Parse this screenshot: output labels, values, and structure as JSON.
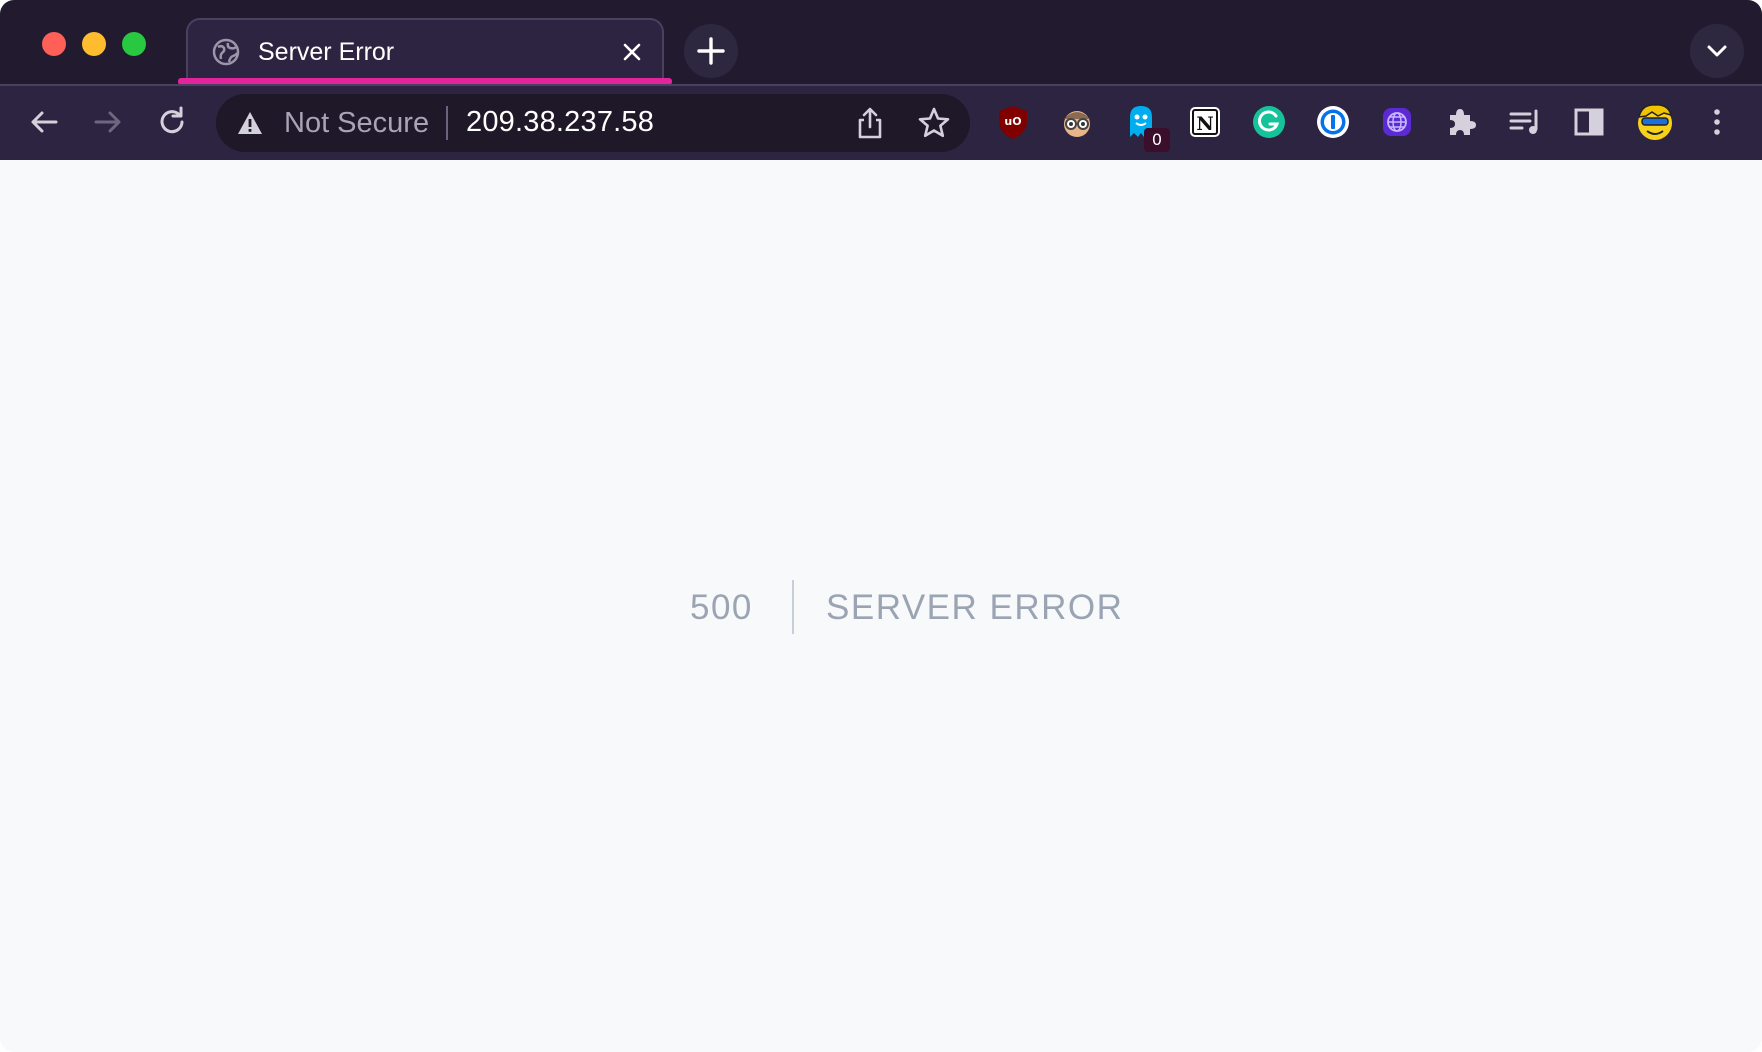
{
  "tab": {
    "title": "Server Error"
  },
  "omnibox": {
    "security_label": "Not Secure",
    "url": "209.38.237.58"
  },
  "extensions": {
    "ghost_badge_count": "0"
  },
  "page": {
    "error_code": "500",
    "error_message": "SERVER ERROR"
  },
  "colors": {
    "tab_accent": "#e3249c",
    "chrome_dark": "#221b30",
    "toolbar": "#2c2440",
    "page_background": "#f8f9fb",
    "error_text": "#9ba4b3"
  },
  "icons": {
    "tab_favicon": "globe-icon",
    "nav": [
      "back-arrow-icon",
      "forward-arrow-icon",
      "reload-icon"
    ],
    "omnibox": [
      "warning-triangle-icon",
      "share-icon",
      "bookmark-star-icon"
    ],
    "extensions": [
      "ublock-origin-icon",
      "glasses-face-icon",
      "ghostery-icon",
      "notion-icon",
      "grammarly-icon",
      "1password-icon",
      "purple-globe-icon",
      "puzzle-extensions-icon",
      "reading-list-icon",
      "side-panel-icon",
      "profile-avatar-icon",
      "more-menu-icon"
    ]
  }
}
